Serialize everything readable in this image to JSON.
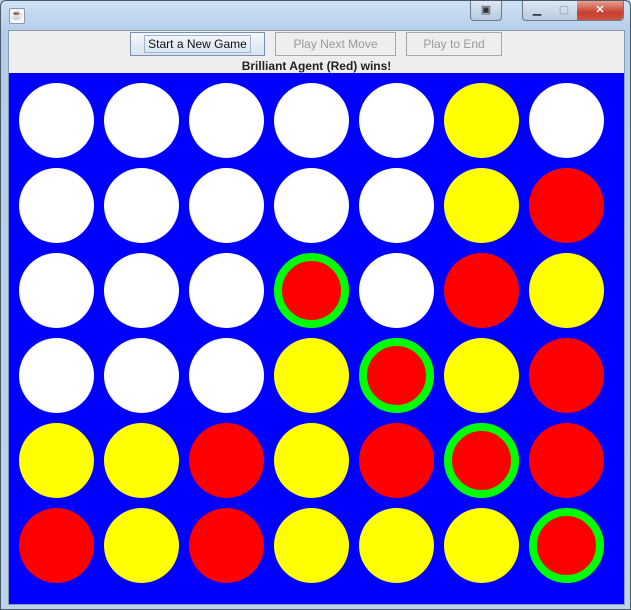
{
  "window": {
    "title": "",
    "controls": [
      "minimize",
      "maximize",
      "close"
    ]
  },
  "toolbar": {
    "new_game_label": "Start a New Game",
    "next_move_label": "Play Next Move",
    "play_to_end_label": "Play to End",
    "next_move_enabled": false,
    "play_to_end_enabled": false
  },
  "status": {
    "message": "Brilliant Agent (Red) wins!"
  },
  "colors": {
    "board": "#0000ff",
    "empty": "#ffffff",
    "red": "#ff0000",
    "yellow": "#ffff00",
    "win_highlight": "#00ff00"
  },
  "board": {
    "rows": 6,
    "columns": 7,
    "cells": [
      [
        "empty",
        "empty",
        "empty",
        "empty",
        "empty",
        "yellow",
        "empty"
      ],
      [
        "empty",
        "empty",
        "empty",
        "empty",
        "empty",
        "yellow",
        "red"
      ],
      [
        "empty",
        "empty",
        "empty",
        "red",
        "empty",
        "red",
        "yellow"
      ],
      [
        "empty",
        "empty",
        "empty",
        "yellow",
        "red",
        "yellow",
        "red"
      ],
      [
        "yellow",
        "yellow",
        "red",
        "yellow",
        "red",
        "red",
        "red"
      ],
      [
        "red",
        "yellow",
        "red",
        "yellow",
        "yellow",
        "yellow",
        "red"
      ]
    ],
    "winning_cells": [
      [
        2,
        3
      ],
      [
        3,
        4
      ],
      [
        4,
        5
      ],
      [
        5,
        6
      ]
    ]
  }
}
